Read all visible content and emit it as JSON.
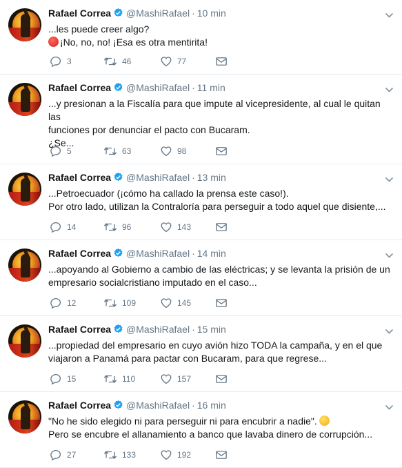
{
  "icons": {
    "verified": "verified-badge-icon",
    "caret": "chevron-down-icon",
    "reply": "reply-icon",
    "retweet": "retweet-icon",
    "like": "heart-icon",
    "message": "envelope-icon"
  },
  "colors": {
    "accent": "#1da1f2",
    "muted": "#657786",
    "text": "#14171a",
    "border": "#e6ecf0"
  },
  "tweets": [
    {
      "name": "Rafael Correa",
      "handle": "@MashiRafael",
      "sep": "·",
      "time": "10 min",
      "lines": [
        "...les puede creer algo?",
        "¡No, no, no! ¡Esa es otra mentirita!"
      ],
      "emoji": "angry-face-emoji",
      "replies": "3",
      "retweets": "46",
      "likes": "77"
    },
    {
      "name": "Rafael Correa",
      "handle": "@MashiRafael",
      "sep": "·",
      "time": "11 min",
      "lines": [
        "...y presionan a la Fiscalía para que impute al vicepresidente, al cual le quitan las",
        "funciones por denunciar el pacto con Bucaram.",
        "¿Se..."
      ],
      "replies": "5",
      "retweets": "63",
      "likes": "98"
    },
    {
      "name": "Rafael Correa",
      "handle": "@MashiRafael",
      "sep": "·",
      "time": "13 min",
      "lines": [
        "...Petroecuador (¡cómo ha callado la prensa este caso!).",
        "Por otro lado, utilizan la Contraloría para perseguir a todo aquel que disiente,..."
      ],
      "replies": "14",
      "retweets": "96",
      "likes": "143"
    },
    {
      "name": "Rafael Correa",
      "handle": "@MashiRafael",
      "sep": "·",
      "time": "14 min",
      "lines": [
        "...apoyando al Gobierno a cambio de las eléctricas; y se levanta la prisión de un",
        "empresario socialcristiano imputado en el caso..."
      ],
      "replies": "12",
      "retweets": "109",
      "likes": "145"
    },
    {
      "name": "Rafael Correa",
      "handle": "@MashiRafael",
      "sep": "·",
      "time": "15 min",
      "lines": [
        "...propiedad del empresario en cuyo avión hizo TODA la campaña, y en el que",
        "viajaron a Panamá para pactar con Bucaram, para que regrese..."
      ],
      "replies": "15",
      "retweets": "110",
      "likes": "157"
    },
    {
      "name": "Rafael Correa",
      "handle": "@MashiRafael",
      "sep": "·",
      "time": "16 min",
      "lines": [
        "\"No he sido elegido ni para perseguir ni para encubrir a nadie\".",
        "Pero se encubre el allanamiento a banco que lavaba dinero de corrupción..."
      ],
      "emoji": "thinking-face-emoji",
      "replies": "27",
      "retweets": "133",
      "likes": "192"
    }
  ]
}
